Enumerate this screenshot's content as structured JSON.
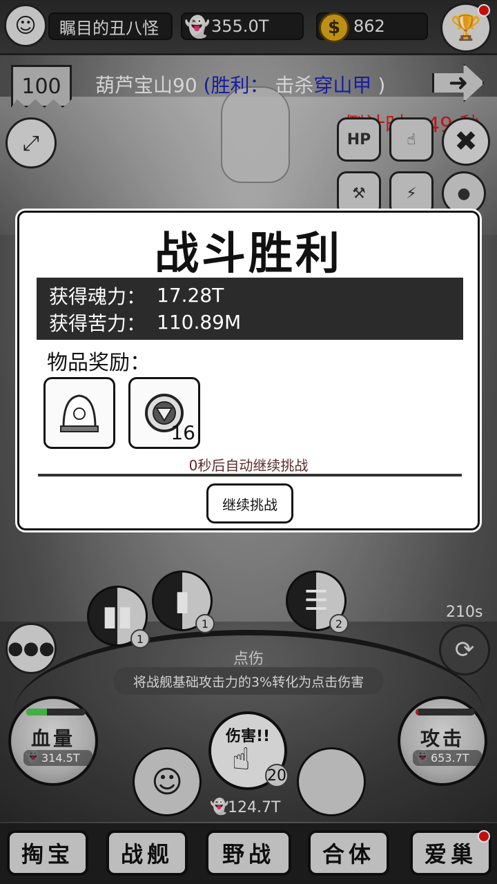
{
  "topbar": {
    "player_name": "瞩目的丑八怪",
    "soul_amount": "355.0T",
    "gold_amount": "862",
    "icons": {
      "avatar": "avatar-icon",
      "soul": "ghost-icon",
      "gold": "dollar-coin-icon",
      "trophy": "trophy-icon"
    }
  },
  "stage": {
    "level_badge": "100",
    "name_prefix": "葫芦宝山90",
    "paren_open": "(",
    "victory_label": "胜利：",
    "kill_label": "击杀",
    "target_name": "穿山甲",
    "paren_close": ")",
    "countdown": "倒计时：49 秒",
    "accent_blue": "#1c22b8",
    "accent_red": "#d61e1e"
  },
  "side_buttons": {
    "hp_label": "HP"
  },
  "dialog": {
    "title": "战斗胜利",
    "rewards": [
      {
        "label": "获得魂力：",
        "value": "17.28T"
      },
      {
        "label": "获得苦力：",
        "value": "110.89M"
      }
    ],
    "items_label": "物品奖励：",
    "items": [
      {
        "icon": "bell-jar-icon",
        "count": ""
      },
      {
        "icon": "reactor-core-icon",
        "count": "16"
      }
    ],
    "auto_text": "0秒后自动继续挑战",
    "continue_label": "继续挑战"
  },
  "skills": {
    "timer": "210s",
    "levels": [
      "1",
      "1",
      "2"
    ],
    "tooltip_title": "点伤",
    "tooltip_text": "将战舰基础攻击力的3%转化为点击伤害"
  },
  "stats": {
    "hp_label": "血量",
    "hp_value": "314.5T",
    "hp_fill": 0.35,
    "atk_label": "攻击",
    "atk_value": "653.7T",
    "atk_fill": 0.05,
    "damage_label": "伤害!!",
    "damage_count": "20",
    "bottom_soul": "124.7T"
  },
  "nav": {
    "items": [
      "掏宝",
      "战舰",
      "野战",
      "合体",
      "爱巢"
    ]
  }
}
